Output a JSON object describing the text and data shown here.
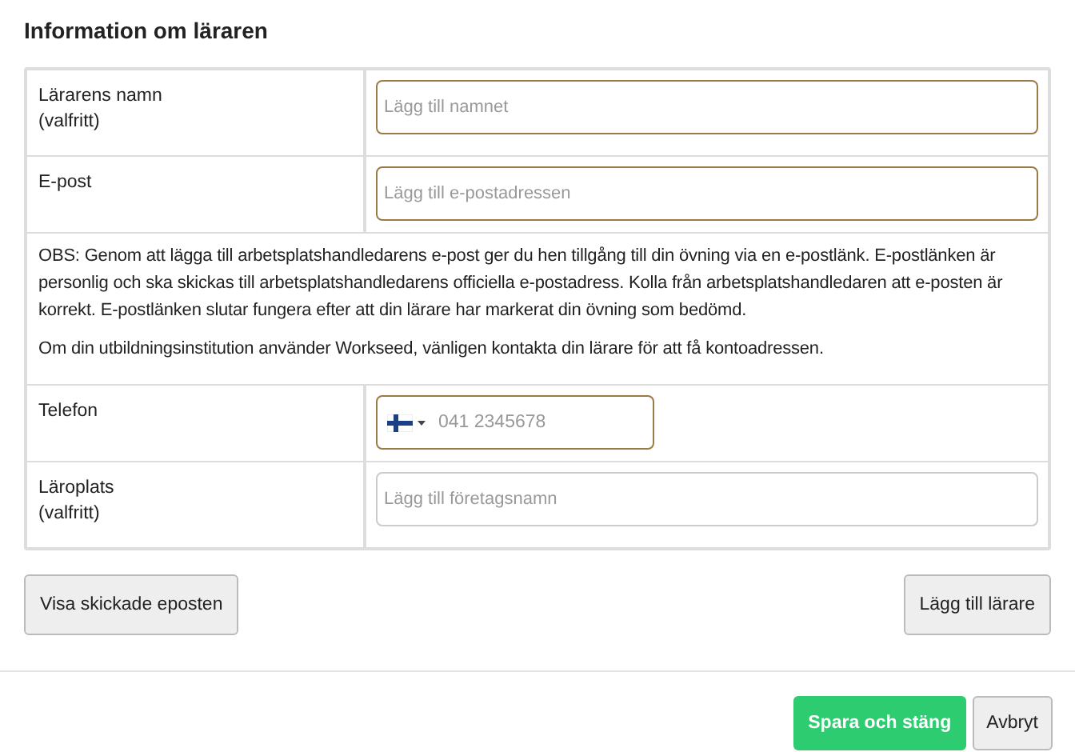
{
  "title": "Information om läraren",
  "rows": [
    {
      "kind": "field",
      "label": "Lärarens namn",
      "sublabel": "(valfritt)",
      "placeholder": "Lägg till namnet",
      "highlighted": true
    },
    {
      "kind": "field",
      "label": "E-post",
      "placeholder": "Lägg till e-postadressen",
      "highlighted": true
    },
    {
      "kind": "note",
      "paragraphs": [
        "OBS: Genom att lägga till arbetsplatshandledarens e-post ger du hen tillgång till din övning via en e-postlänk. E-postlänken är personlig och ska skickas till arbetsplatshandledarens officiella e-postadress. Kolla från arbetsplatshandledaren att e-posten är korrekt. E-postlänken slutar fungera efter att din lärare har markerat din övning som bedömd.",
        "Om din utbildningsinstitution använder Workseed, vänligen kontakta din lärare för att få kontoadressen."
      ]
    },
    {
      "kind": "phone",
      "label": "Telefon",
      "placeholder": "041 2345678",
      "highlighted": true
    },
    {
      "kind": "field",
      "label": "Läroplats",
      "sublabel": "(valfritt)",
      "placeholder": "Lägg till företagsnamn",
      "highlighted": false
    }
  ],
  "actions": {
    "left": "Visa skickade eposten",
    "right": "Lägg till lärare"
  },
  "footer": [
    {
      "label": "Spara och stäng",
      "kind": "primary"
    },
    {
      "label": "Avbryt",
      "kind": "default"
    }
  ]
}
